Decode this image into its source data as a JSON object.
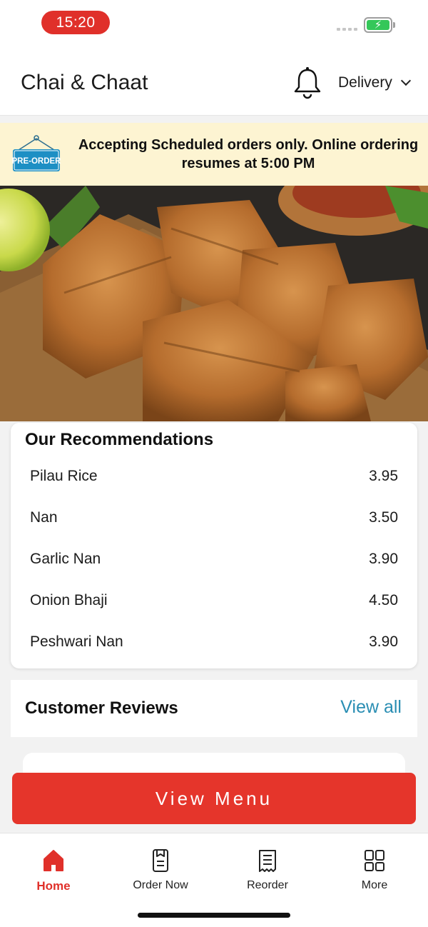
{
  "status_bar": {
    "time": "15:20",
    "time_pill_color": "#e0302a",
    "battery_color": "#34c759",
    "battery_state": "charging"
  },
  "header": {
    "title": "Chai & Chaat",
    "delivery_mode": "Delivery",
    "bell_icon": "bell-icon"
  },
  "banner": {
    "badge_text": "PRE-ORDER",
    "message": "Accepting Scheduled orders only. Online ordering resumes at 5:00 PM",
    "background": "#fdf4d2"
  },
  "hero": {
    "image": "samosas-photo"
  },
  "recommendations": {
    "title": "Our Recommendations",
    "items": [
      {
        "name": "Pilau Rice",
        "price": "3.95"
      },
      {
        "name": "Nan",
        "price": "3.50"
      },
      {
        "name": "Garlic Nan",
        "price": "3.90"
      },
      {
        "name": "Onion Bhaji",
        "price": "4.50"
      },
      {
        "name": "Peshwari Nan",
        "price": "3.90"
      }
    ]
  },
  "reviews": {
    "title": "Customer Reviews",
    "view_all": "View all",
    "link_color": "#2a8eb3"
  },
  "cta": {
    "view_menu": "View Menu",
    "color": "#e5352b"
  },
  "bottom_nav": {
    "active_color": "#e0302a",
    "items": [
      {
        "label": "Home",
        "icon": "home-icon",
        "active": true
      },
      {
        "label": "Order Now",
        "icon": "order-icon",
        "active": false
      },
      {
        "label": "Reorder",
        "icon": "receipt-icon",
        "active": false
      },
      {
        "label": "More",
        "icon": "grid-icon",
        "active": false
      }
    ]
  }
}
